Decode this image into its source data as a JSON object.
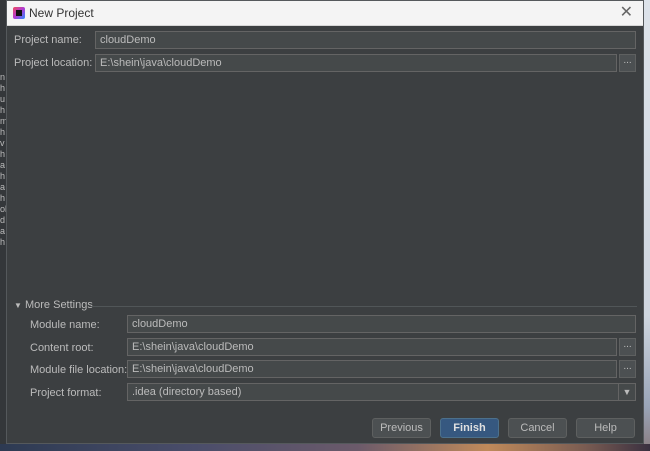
{
  "window": {
    "title": "New Project"
  },
  "form": {
    "project_name_label": "Project name:",
    "project_name_value": "cloudDemo",
    "project_location_label": "Project location:",
    "project_location_value": "E:\\shein\\java\\cloudDemo",
    "browse_label": "..."
  },
  "more_settings": {
    "header": "More Settings",
    "module_name_label": "Module name:",
    "module_name_value": "cloudDemo",
    "content_root_label": "Content root:",
    "content_root_value": "E:\\shein\\java\\cloudDemo",
    "module_file_location_label": "Module file location:",
    "module_file_location_value": "E:\\shein\\java\\cloudDemo",
    "project_format_label": "Project format:",
    "project_format_value": ".idea (directory based)"
  },
  "buttons": {
    "previous": "Previous",
    "finish": "Finish",
    "cancel": "Cancel",
    "help": "Help"
  },
  "background_left_letters": [
    "n",
    "h",
    "u",
    "h",
    "m",
    "h",
    "v",
    "h",
    "a",
    "h",
    "a",
    "h",
    "ol",
    "d",
    "a",
    "h"
  ]
}
